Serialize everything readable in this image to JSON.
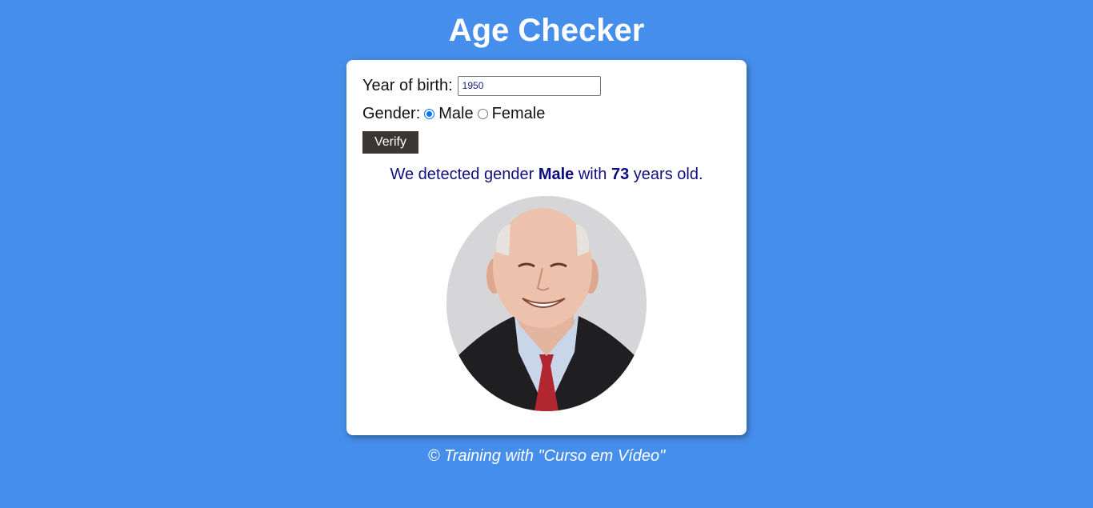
{
  "page": {
    "title": "Age Checker",
    "background_color": "#468eeb"
  },
  "form": {
    "year_label": "Year of birth:",
    "year_value": "1950",
    "gender_label": "Gender:",
    "gender_options": [
      {
        "label": "Male",
        "checked": true
      },
      {
        "label": "Female",
        "checked": false
      }
    ],
    "verify_label": "Verify"
  },
  "result": {
    "prefix": "We detected gender",
    "gender": "Male",
    "middle": "with",
    "age": "73",
    "suffix": "years old."
  },
  "photo": {
    "subject": "elderly-man-portrait"
  },
  "footer": {
    "text": "© Training with \"Curso em Vídeo\""
  }
}
